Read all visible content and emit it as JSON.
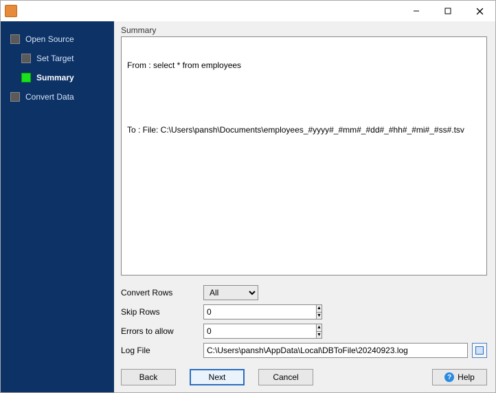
{
  "titlebar": {
    "title": ""
  },
  "sidebar": {
    "items": [
      {
        "label": "Open Source",
        "active": false
      },
      {
        "label": "Set Target",
        "active": false
      },
      {
        "label": "Summary",
        "active": true
      },
      {
        "label": "Convert Data",
        "active": false
      }
    ]
  },
  "summary": {
    "heading": "Summary",
    "from": "From : select * from employees",
    "to": "To : File: C:\\Users\\pansh\\Documents\\employees_#yyyy#_#mm#_#dd#_#hh#_#mi#_#ss#.tsv"
  },
  "form": {
    "convert_rows_label": "Convert Rows",
    "convert_rows_value": "All",
    "skip_rows_label": "Skip Rows",
    "skip_rows_value": "0",
    "errors_label": "Errors to allow",
    "errors_value": "0",
    "logfile_label": "Log File",
    "logfile_value": "C:\\Users\\pansh\\AppData\\Local\\DBToFile\\20240923.log"
  },
  "buttons": {
    "back": "Back",
    "next": "Next",
    "cancel": "Cancel",
    "help": "Help"
  }
}
